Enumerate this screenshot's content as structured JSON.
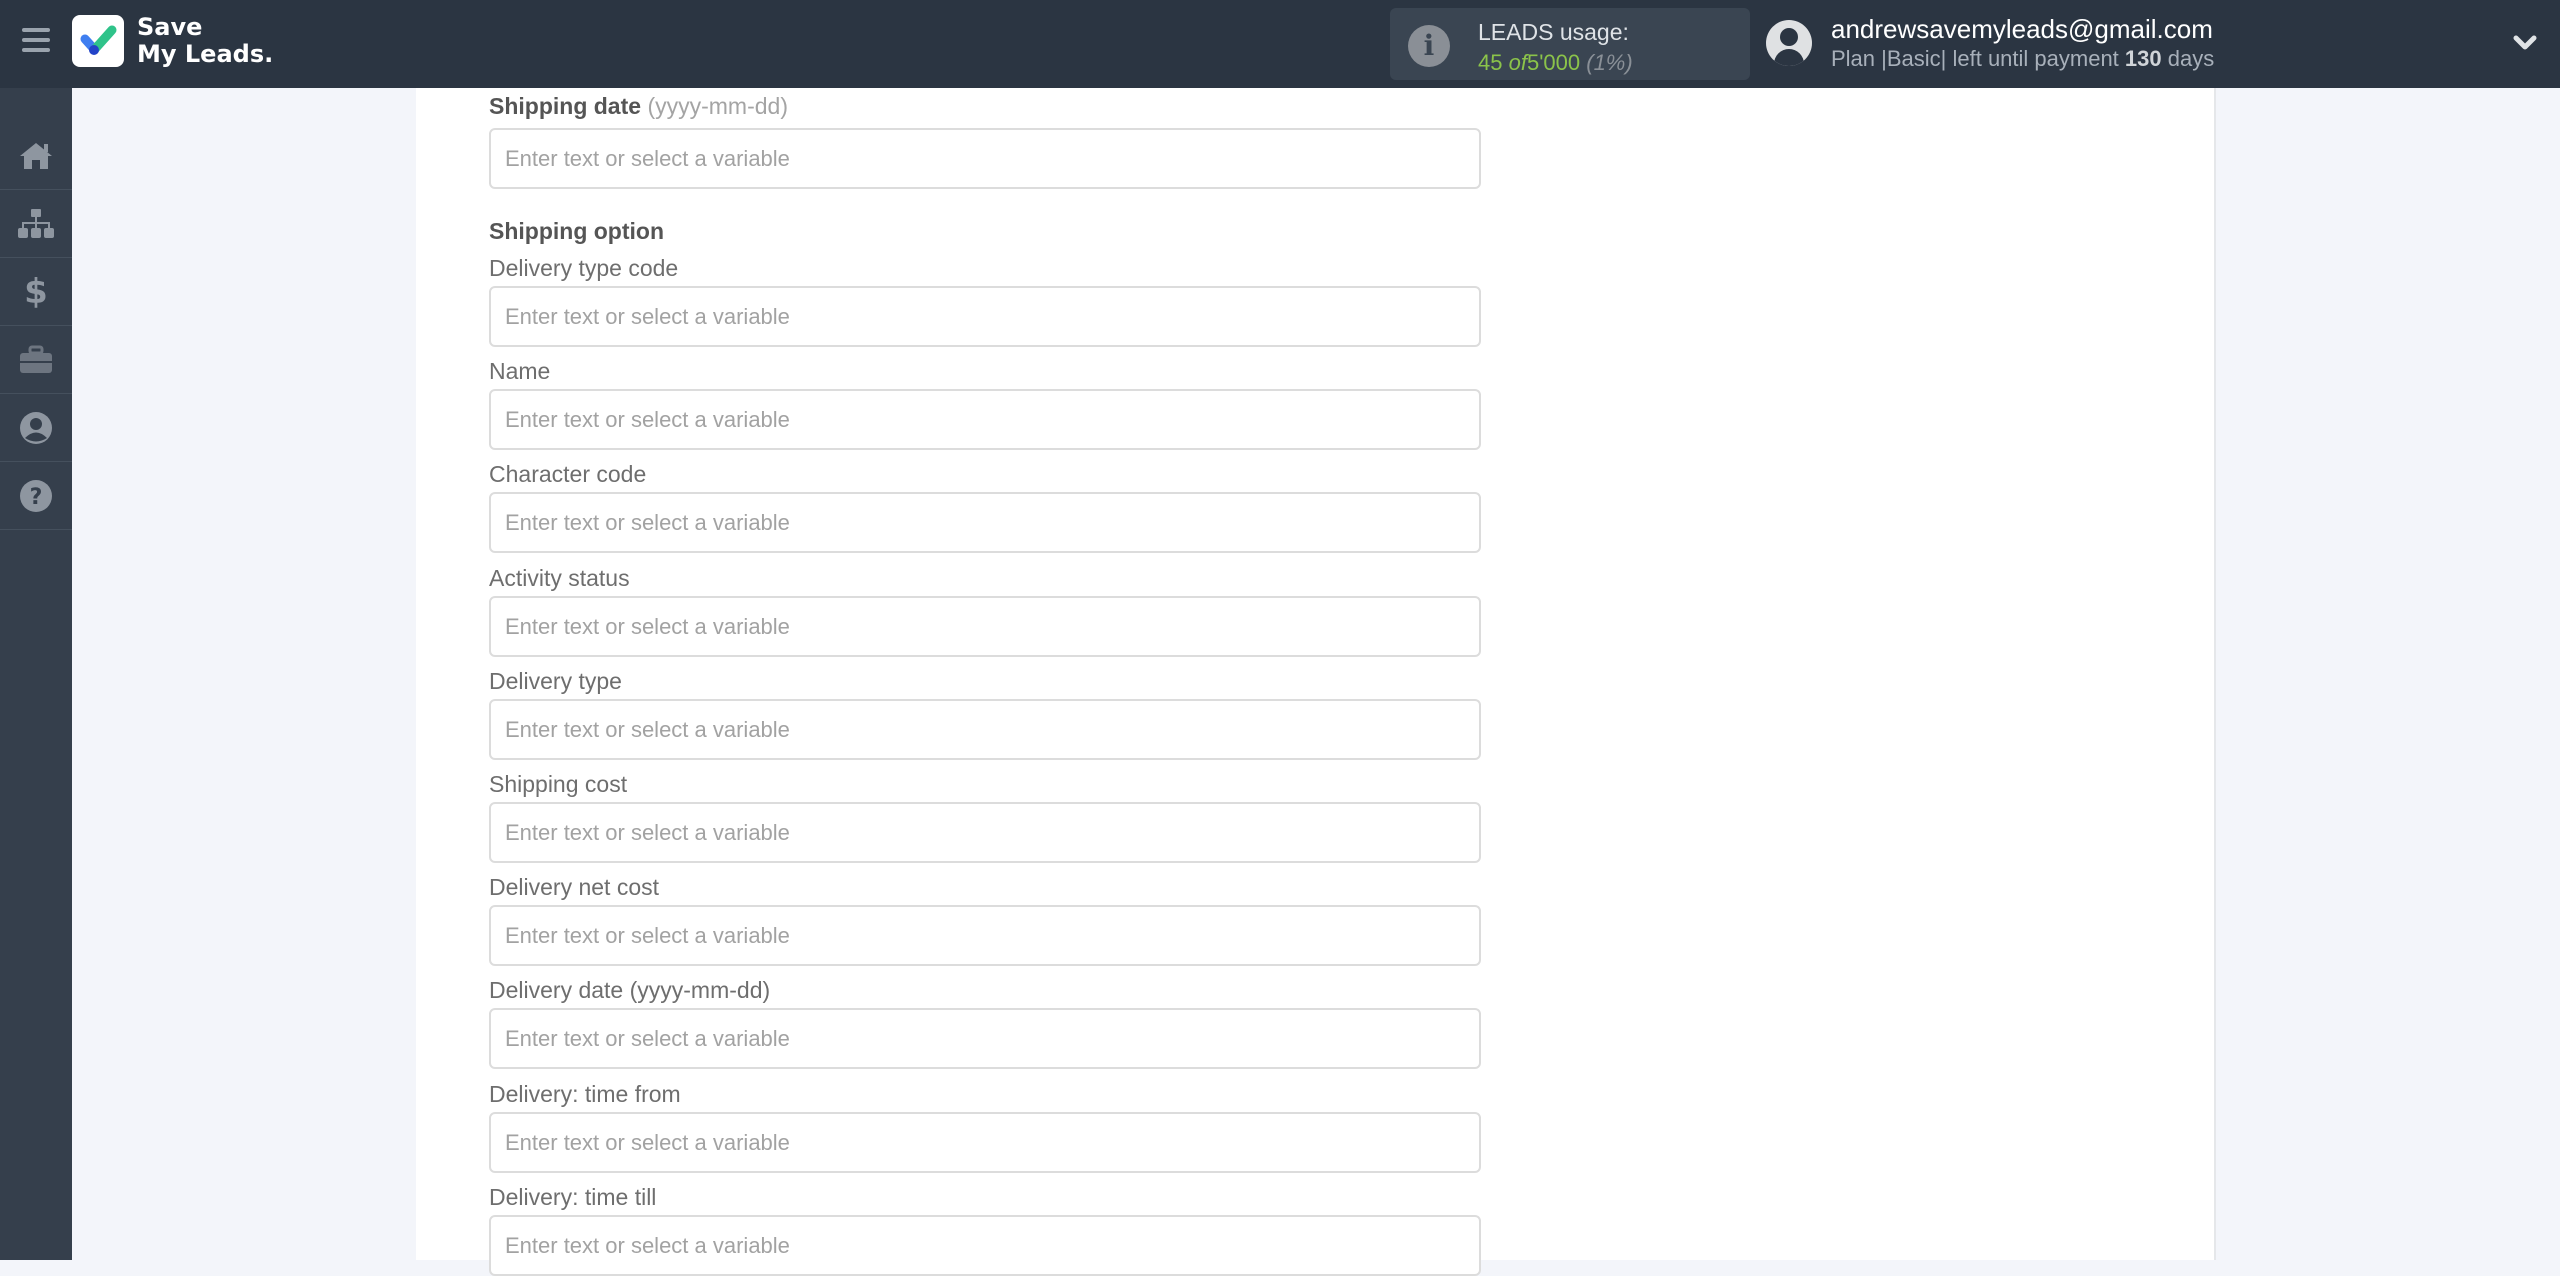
{
  "header": {
    "logo_line1": "Save",
    "logo_line2": "My Leads.",
    "usage": {
      "title": "LEADS usage:",
      "used": "45",
      "of": "of",
      "limit": "5'000",
      "percent": "(1%)"
    },
    "user": {
      "email": "andrewsavemyleads@gmail.com",
      "plan_prefix": "Plan |Basic| left until payment",
      "days": "130",
      "days_suffix": "days"
    }
  },
  "sidebar": {
    "items": [
      {
        "icon": "home-icon",
        "label": "Home"
      },
      {
        "icon": "sitemap-icon",
        "label": "Connections"
      },
      {
        "icon": "dollar-icon",
        "label": "Billing"
      },
      {
        "icon": "briefcase-icon",
        "label": "Tools"
      },
      {
        "icon": "user-circle-icon",
        "label": "Account"
      },
      {
        "icon": "question-circle-icon",
        "label": "Help"
      }
    ]
  },
  "form": {
    "shipping_date": {
      "label": "Shipping date",
      "hint": "(yyyy-mm-dd)",
      "placeholder": "Enter text or select a variable",
      "value": ""
    },
    "section_title": "Shipping option",
    "fields": [
      {
        "label": "Delivery type code",
        "placeholder": "Enter text or select a variable",
        "value": ""
      },
      {
        "label": "Name",
        "placeholder": "Enter text or select a variable",
        "value": ""
      },
      {
        "label": "Character code",
        "placeholder": "Enter text or select a variable",
        "value": ""
      },
      {
        "label": "Activity status",
        "placeholder": "Enter text or select a variable",
        "value": ""
      },
      {
        "label": "Delivery type",
        "placeholder": "Enter text or select a variable",
        "value": ""
      },
      {
        "label": "Shipping cost",
        "placeholder": "Enter text or select a variable",
        "value": ""
      },
      {
        "label": "Delivery net cost",
        "placeholder": "Enter text or select a variable",
        "value": ""
      },
      {
        "label": "Delivery date (yyyy-mm-dd)",
        "placeholder": "Enter text or select a variable",
        "value": ""
      },
      {
        "label": "Delivery: time from",
        "placeholder": "Enter text or select a variable",
        "value": ""
      },
      {
        "label": "Delivery: time till",
        "placeholder": "Enter text or select a variable",
        "value": ""
      }
    ]
  },
  "colors": {
    "header_bg": "#2b3542",
    "sidebar_bg": "#353f4c",
    "usage_green": "#8bc34a",
    "logo_green": "#2fc38a",
    "logo_blue": "#3f7ef0"
  }
}
